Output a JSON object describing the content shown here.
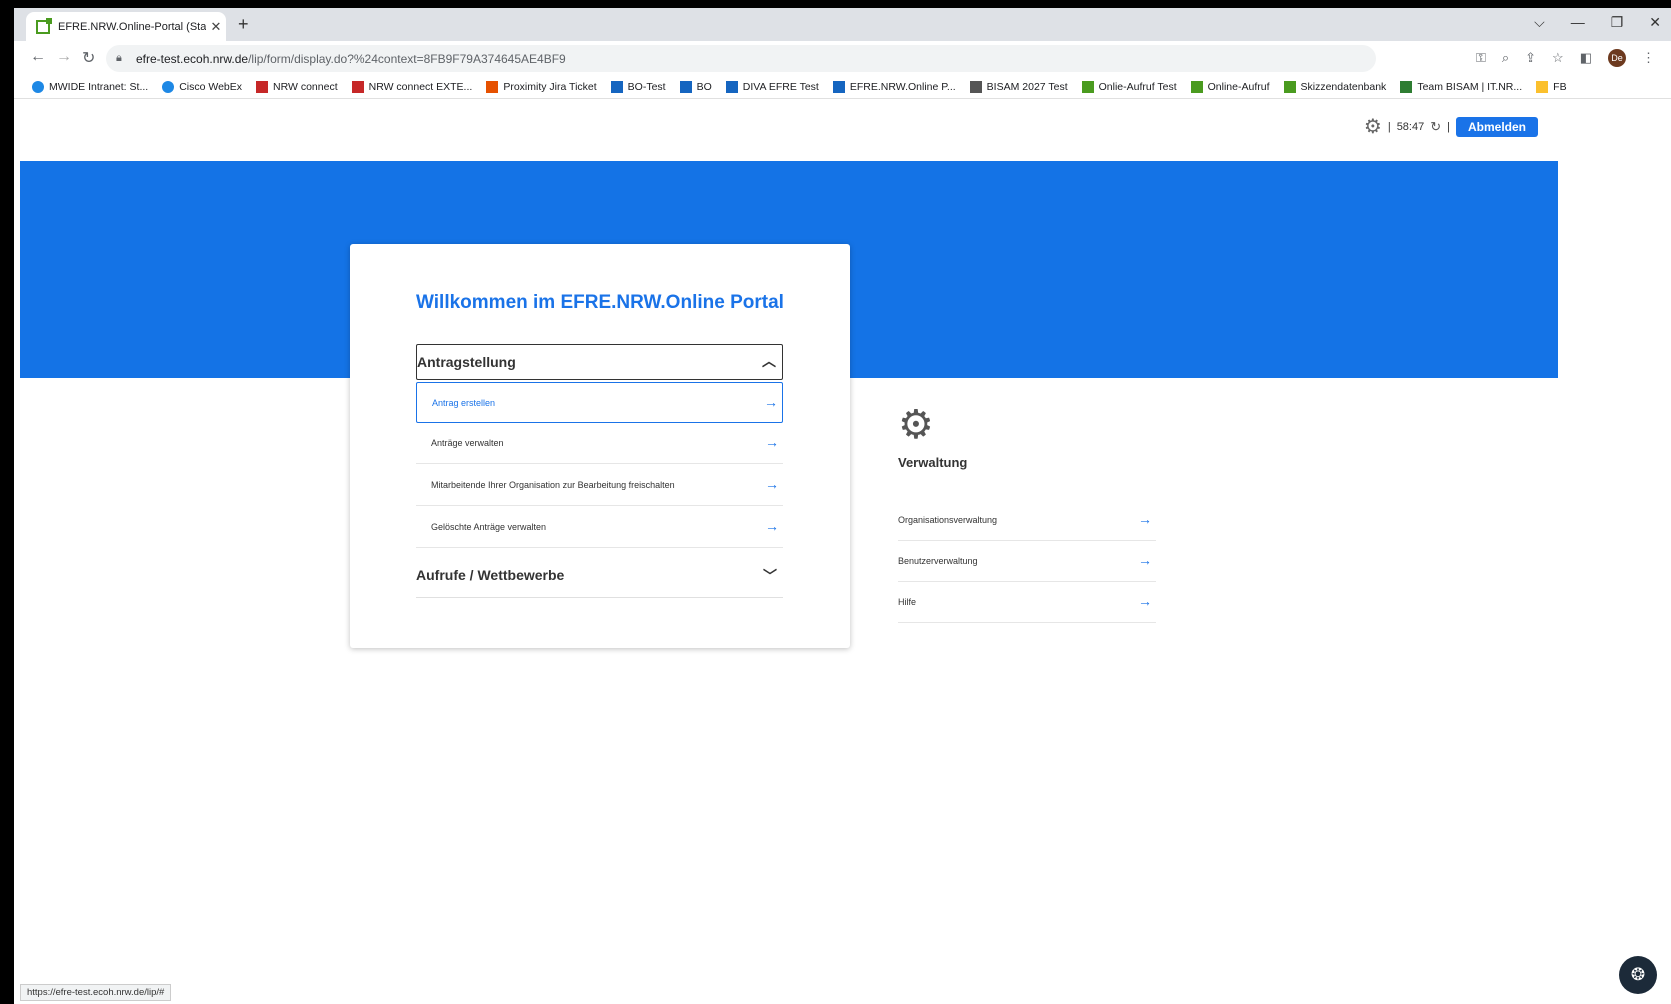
{
  "browser": {
    "tab_title": "EFRE.NRW.Online-Portal (Startseite)",
    "tab_close": "✕",
    "new_tab": "+",
    "window_controls": [
      "⌵",
      "—",
      "❐",
      "✕"
    ],
    "url_host": "efre-test.ecoh.nrw.de",
    "url_path": "/lip/form/display.do?%24context=8FB9F79A374645AE4BF9",
    "profile_initials": "De",
    "bookmarks": [
      {
        "label": "MWIDE Intranet: St...",
        "icon_color": "#1e88e5"
      },
      {
        "label": "Cisco WebEx",
        "icon_color": "#1e88e5"
      },
      {
        "label": "NRW connect",
        "icon_color": "#c62828"
      },
      {
        "label": "NRW connect EXTE...",
        "icon_color": "#c62828"
      },
      {
        "label": "Proximity Jira Ticket",
        "icon_color": "#e65100"
      },
      {
        "label": "BO-Test",
        "icon_color": "#1565c0"
      },
      {
        "label": "BO",
        "icon_color": "#1565c0"
      },
      {
        "label": "DIVA EFRE Test",
        "icon_color": "#1565c0"
      },
      {
        "label": "EFRE.NRW.Online P...",
        "icon_color": "#1565c0"
      },
      {
        "label": "BISAM 2027 Test",
        "icon_color": "#555555"
      },
      {
        "label": "Onlie-Aufruf Test",
        "icon_color": "#4a9b1f"
      },
      {
        "label": "Online-Aufruf",
        "icon_color": "#4a9b1f"
      },
      {
        "label": "Skizzendatenbank",
        "icon_color": "#4a9b1f"
      },
      {
        "label": "Team BISAM | IT.NR...",
        "icon_color": "#2e7d32"
      },
      {
        "label": "FB",
        "icon_color": "#fbc02d"
      }
    ],
    "status_url": "https://efre-test.ecoh.nrw.de/lip/#"
  },
  "header": {
    "timer": "58:47",
    "separator": "|",
    "logout_label": "Abmelden"
  },
  "card": {
    "title": "Willkommen im EFRE.NRW.Online Portal",
    "section1_title": "Antragstellung",
    "section1_items": [
      "Antrag erstellen",
      "Anträge verwalten",
      "Mitarbeitende Ihrer Organisation zur Bearbeitung freischalten",
      "Gelöschte Anträge verwalten"
    ],
    "section2_title": "Aufrufe / Wettbewerbe"
  },
  "admin": {
    "title": "Verwaltung",
    "items": [
      "Organisationsverwaltung",
      "Benutzerverwaltung",
      "Hilfe"
    ]
  },
  "colors": {
    "accent": "#1a73e8",
    "band": "#1473e6"
  }
}
